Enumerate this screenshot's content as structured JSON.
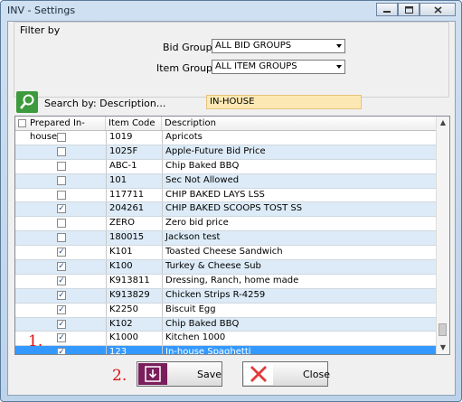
{
  "window": {
    "title": "INV - Settings"
  },
  "filter": {
    "legend": "Filter by",
    "bid_group_label": "Bid Group:",
    "bid_group_value": "ALL BID GROUPS",
    "item_group_label": "Item Group:",
    "item_group_value": "ALL ITEM GROUPS"
  },
  "search": {
    "label": "Search by: Description...",
    "value": "IN-HOUSE"
  },
  "grid": {
    "headers": [
      "Prepared In-house",
      "Item Code",
      "Description"
    ],
    "rows": [
      {
        "checked": false,
        "code": "1019",
        "desc": "Apricots"
      },
      {
        "checked": false,
        "code": "1025F",
        "desc": "Apple-Future Bid Price"
      },
      {
        "checked": false,
        "code": "ABC-1",
        "desc": "Chip Baked BBQ"
      },
      {
        "checked": false,
        "code": "101",
        "desc": "Sec Not Allowed"
      },
      {
        "checked": false,
        "code": "117711",
        "desc": "CHIP BAKED LAYS LSS"
      },
      {
        "checked": true,
        "code": "204261",
        "desc": "CHIP BAKED SCOOPS TOST SS"
      },
      {
        "checked": false,
        "code": "ZERO",
        "desc": "Zero bid price"
      },
      {
        "checked": false,
        "code": "180015",
        "desc": "Jackson test"
      },
      {
        "checked": true,
        "code": "K101",
        "desc": "Toasted Cheese Sandwich"
      },
      {
        "checked": true,
        "code": "K100",
        "desc": "Turkey & Cheese Sub"
      },
      {
        "checked": true,
        "code": "K913811",
        "desc": "Dressing, Ranch, home made"
      },
      {
        "checked": true,
        "code": "K913829",
        "desc": "Chicken Strips R-4259"
      },
      {
        "checked": true,
        "code": "K2250",
        "desc": "Biscuit Egg"
      },
      {
        "checked": true,
        "code": "K102",
        "desc": "Chip Baked BBQ"
      },
      {
        "checked": true,
        "code": "K1000",
        "desc": "Kitchen 1000"
      },
      {
        "checked": true,
        "code": "123",
        "desc": "In-house Spaghetti"
      }
    ],
    "selected_row": 15
  },
  "annotations": {
    "one": "1.",
    "two": "2."
  },
  "buttons": {
    "save": "Save",
    "close": "Close"
  },
  "colors": {
    "selection": "#3399ff",
    "alt_row": "#dcebf7",
    "search_bg": "#fce8b3",
    "search_icon_bg": "#3d9a3d",
    "save_icon": "#7a1f5c",
    "close_icon": "#e23a3a"
  },
  "icons": {
    "search": "magnifier-icon",
    "save": "save-icon",
    "close": "close-x-icon"
  }
}
